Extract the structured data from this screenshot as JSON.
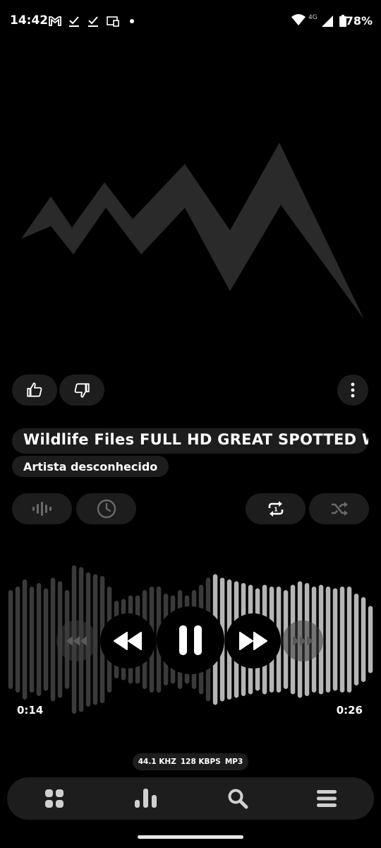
{
  "status_bar": {
    "time": "14:42",
    "network": "4G",
    "battery": "78%",
    "icons": [
      "gmail-icon",
      "check-icon",
      "check-icon",
      "cast-icon",
      "dot-icon",
      "wifi-icon",
      "signal-icon",
      "battery-icon"
    ]
  },
  "track": {
    "title": "Wildlife Files FULL HD GREAT SPOTTED W",
    "artist": "Artista desconhecido"
  },
  "actions": {
    "like_icon": "thumbs-up-icon",
    "dislike_icon": "thumbs-down-icon",
    "more_icon": "more-vertical-icon"
  },
  "options": {
    "equalizer_icon": "waveform-icon",
    "sleep_timer_icon": "clock-icon",
    "repeat_icon": "repeat-one-icon",
    "shuffle_icon": "shuffle-icon"
  },
  "playback": {
    "elapsed": "0:14",
    "total": "0:26",
    "progress": 0.54,
    "state": "playing"
  },
  "format": {
    "sample_rate": "44.1 KHZ",
    "bitrate": "128 KBPS",
    "codec": "MP3"
  },
  "nav": [
    "grid-icon",
    "bar-chart-icon",
    "search-icon",
    "menu-icon"
  ],
  "colors": {
    "background": "#000000",
    "surface": "#1d1d1d",
    "wave_played": "#3a3a3a",
    "wave_unplayed": "#b5b5b5",
    "art": "#2a2a2a"
  }
}
